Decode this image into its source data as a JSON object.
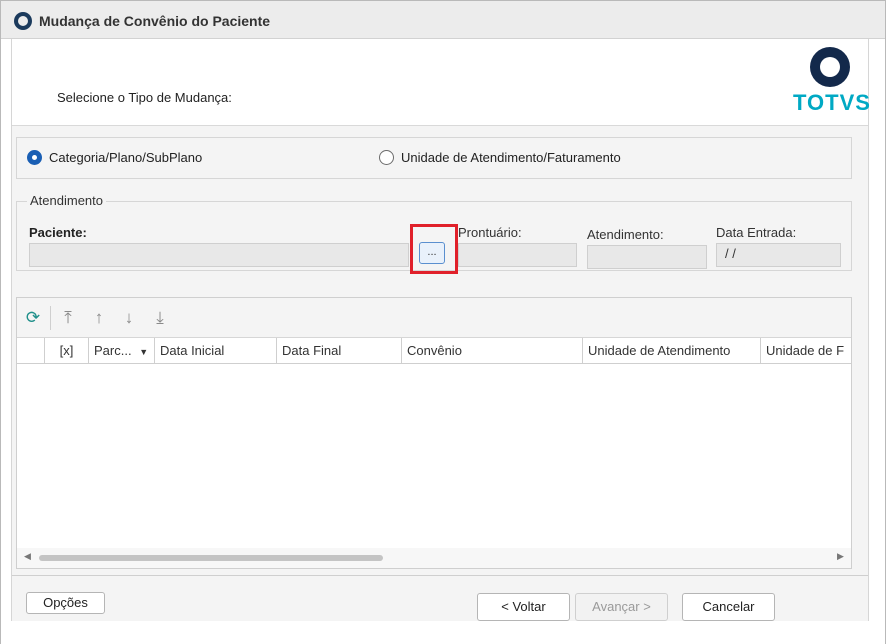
{
  "window": {
    "title": "Mudança de Convênio do Paciente"
  },
  "header": {
    "select_label": "Selecione o Tipo de Mudança:",
    "logo_text": "TOTVS"
  },
  "change_type": {
    "options": [
      {
        "label": "Categoria/Plano/SubPlano",
        "checked": true
      },
      {
        "label": "Unidade de Atendimento/Faturamento",
        "checked": false
      }
    ]
  },
  "atendimento": {
    "legend": "Atendimento",
    "paciente_label": "Paciente:",
    "paciente_value": "",
    "lookup_label": "...",
    "prontuario_label": "Prontuário:",
    "prontuario_value": "",
    "atendimento_label": "Atendimento:",
    "atendimento_value": "",
    "data_entrada_label": "Data Entrada:",
    "data_entrada_value": "/ /"
  },
  "grid": {
    "columns": [
      "[x]",
      "Parc...",
      "Data Inicial",
      "Data Final",
      "Convênio",
      "Unidade de Atendimento",
      "Unidade de F"
    ],
    "rows": []
  },
  "footer": {
    "options_label": "Opções",
    "back_label": "< Voltar",
    "next_label": "Avançar >",
    "cancel_label": "Cancelar"
  },
  "colors": {
    "accent": "#1a5fb4",
    "highlight": "#e0202a",
    "logo": "#00a9c4"
  }
}
